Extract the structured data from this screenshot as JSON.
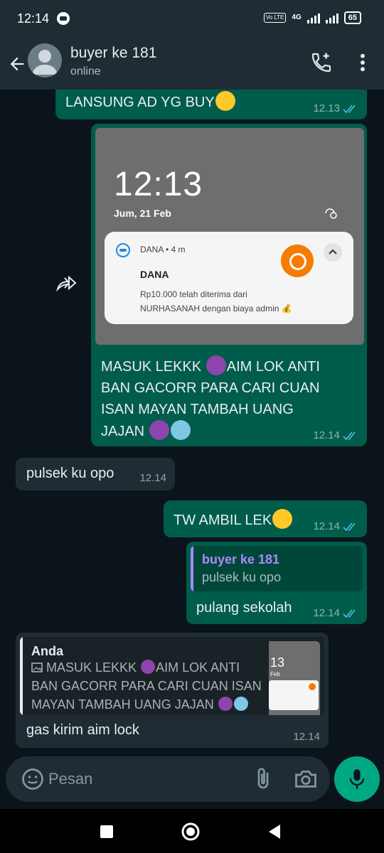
{
  "status_bar": {
    "time": "12:14",
    "network": "4G",
    "volte": "Vo LTE",
    "battery": "65"
  },
  "header": {
    "contact_name": "buyer ke 181",
    "status": "online"
  },
  "messages": [
    {
      "id": "m1",
      "direction": "outgoing",
      "text": "LANSUNG AD YG BUY",
      "time": "12.13",
      "read": true
    },
    {
      "id": "m2",
      "direction": "outgoing",
      "forwarded": true,
      "time": "12.14",
      "read": true,
      "image": {
        "clock": "12:13",
        "date": "Jum, 21 Feb",
        "notification": {
          "app": "DANA • 4 m",
          "title": "DANA",
          "body": "Rp10.000 telah diterima dari NURHASANAH dengan biaya admin 💰"
        }
      },
      "caption_lines": [
        "MASUK LEKKK",
        "AIM LOK ANTI",
        "BAN GACORR PARA CARI CUAN",
        "ISAN MAYAN TAMBAH UANG",
        "JAJAN"
      ]
    },
    {
      "id": "m3",
      "direction": "incoming",
      "text": "pulsek ku opo",
      "time": "12.14"
    },
    {
      "id": "m4",
      "direction": "outgoing",
      "text": "TW AMBIL LEK",
      "time": "12.14",
      "read": true
    },
    {
      "id": "m5",
      "direction": "outgoing",
      "quote": {
        "name": "buyer ke 181",
        "text": "pulsek ku opo"
      },
      "text": "pulang sekolah",
      "time": "12.14",
      "read": true
    },
    {
      "id": "m6",
      "direction": "incoming",
      "quote": {
        "name": "Anda",
        "lines": [
          "MASUK LEKKK",
          "AIM LOK ANTI",
          "BAN GACORR PARA CARI CUAN ISAN",
          "MAYAN TAMBAH UANG JAJAN"
        ],
        "thumb_clock": "13",
        "thumb_date": "Feb"
      },
      "text": "gas kirim aim lock",
      "time": "12.14"
    }
  ],
  "composer": {
    "placeholder": "Pesan"
  },
  "colors": {
    "outgoing": "#005c4b",
    "incoming": "#202c33",
    "accent": "#00a884",
    "read_ticks": "#53bdeb",
    "quote_bar_purple": "#a78bfa",
    "quote_name_blue": "#53bdeb"
  },
  "icons": [
    "back-arrow-icon",
    "avatar",
    "add-call-icon",
    "more-vert-icon",
    "forward-icon",
    "emoji-icon",
    "attach-icon",
    "camera-icon",
    "mic-icon",
    "nav-recent-icon",
    "nav-home-icon",
    "nav-back-icon"
  ]
}
